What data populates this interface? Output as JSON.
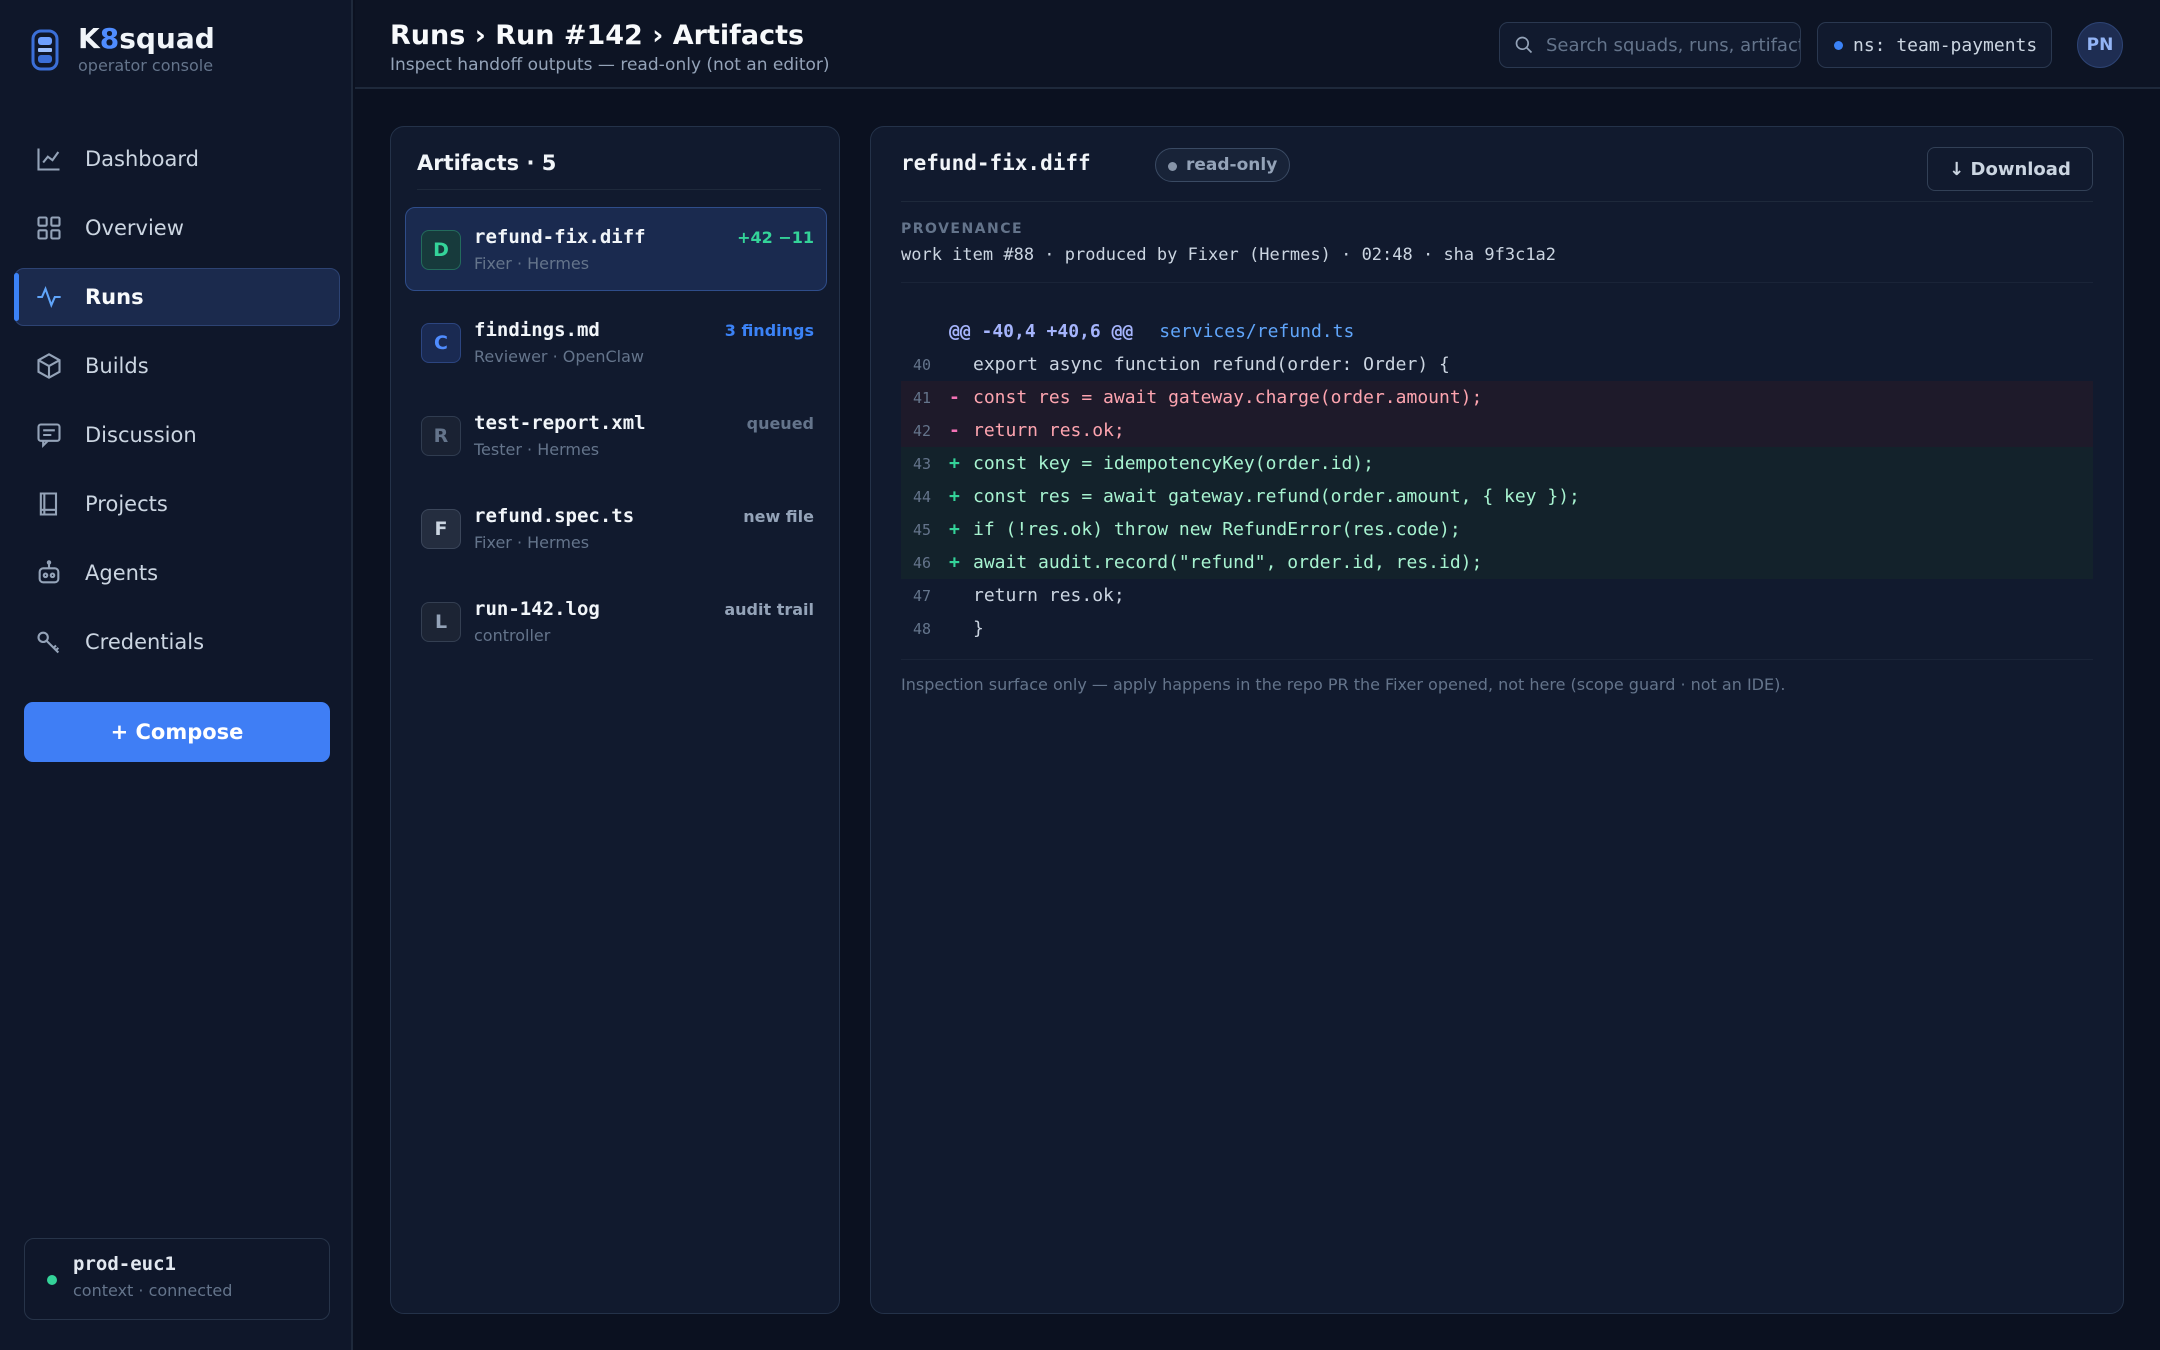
{
  "brand": {
    "name_prefix": "K",
    "name_accent": "8",
    "name_suffix": "squad",
    "subtitle": "operator console"
  },
  "nav": {
    "items": [
      {
        "label": "Dashboard",
        "icon": "chart-line-icon"
      },
      {
        "label": "Overview",
        "icon": "grid-icon"
      },
      {
        "label": "Runs",
        "icon": "activity-icon",
        "active": true
      },
      {
        "label": "Builds",
        "icon": "box-icon"
      },
      {
        "label": "Discussion",
        "icon": "message-icon"
      },
      {
        "label": "Projects",
        "icon": "book-icon"
      },
      {
        "label": "Agents",
        "icon": "robot-icon"
      },
      {
        "label": "Credentials",
        "icon": "key-icon"
      }
    ],
    "compose_label": "+ Compose"
  },
  "context": {
    "name": "prod-euc1",
    "status": "context · connected"
  },
  "header": {
    "title": "Runs › Run #142 › Artifacts",
    "subtitle": "Inspect handoff outputs — read-only (not an editor)",
    "search_placeholder": "Search squads, runs, artifacts…",
    "namespace": "ns: team-payments",
    "avatar_initials": "PN"
  },
  "artifacts": {
    "title": "Artifacts · 5",
    "items": [
      {
        "badge": "D",
        "name": "refund-fix.diff",
        "meta": "Fixer · Hermes",
        "stat": "+42 −11",
        "stat_color": "#34d399",
        "active": true
      },
      {
        "badge": "C",
        "name": "findings.md",
        "meta": "Reviewer · OpenClaw",
        "stat": "3 findings",
        "stat_color": "#3b82f6"
      },
      {
        "badge": "R",
        "name": "test-report.xml",
        "meta": "Tester · Hermes",
        "stat": "queued",
        "stat_color": "#64748b"
      },
      {
        "badge": "F",
        "name": "refund.spec.ts",
        "meta": "Fixer · Hermes",
        "stat": "new file",
        "stat_color": "#94a3b8"
      },
      {
        "badge": "L",
        "name": "run-142.log",
        "meta": "controller",
        "stat": "audit trail",
        "stat_color": "#94a3b8"
      }
    ]
  },
  "detail": {
    "title": "refund-fix.diff",
    "badge": "read-only",
    "download_label": "↓ Download",
    "provenance_label": "PROVENANCE",
    "provenance": "work item #88 · produced by Fixer (Hermes) · 02:48 · sha 9f3c1a2",
    "hunk_range": "@@ -40,4 +40,6 @@",
    "hunk_file": "services/refund.ts",
    "lines": [
      {
        "num": "40",
        "sign": "",
        "kind": "ctx",
        "text": "export async function refund(order: Order) {"
      },
      {
        "num": "41",
        "sign": "-",
        "kind": "del",
        "text": "const res = await gateway.charge(order.amount);"
      },
      {
        "num": "42",
        "sign": "-",
        "kind": "del",
        "text": "return res.ok;"
      },
      {
        "num": "43",
        "sign": "+",
        "kind": "add",
        "text": "const key = idempotencyKey(order.id);"
      },
      {
        "num": "44",
        "sign": "+",
        "kind": "add",
        "text": "const res = await gateway.refund(order.amount, { key });"
      },
      {
        "num": "45",
        "sign": "+",
        "kind": "add",
        "text": "if (!res.ok) throw new RefundError(res.code);"
      },
      {
        "num": "46",
        "sign": "+",
        "kind": "add",
        "text": "await audit.record(\"refund\", order.id, res.id);"
      },
      {
        "num": "47",
        "sign": "",
        "kind": "ctx",
        "text": "return res.ok;"
      },
      {
        "num": "48",
        "sign": "",
        "kind": "ctx",
        "text": "}"
      }
    ],
    "note": "Inspection surface only — apply happens in the repo PR the Fixer opened, not here (scope guard · not an IDE)."
  },
  "colors": {
    "accent": "#3f7ef5",
    "success": "#34d399",
    "background": "#0b1120"
  }
}
